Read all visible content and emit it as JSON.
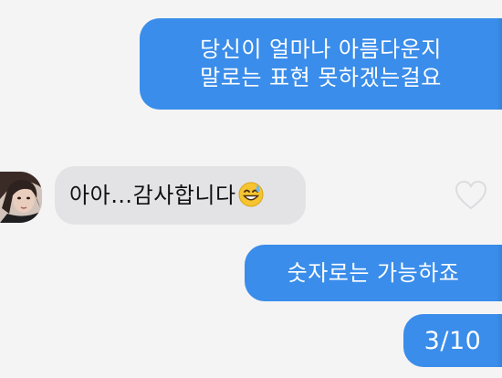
{
  "messages": [
    {
      "direction": "sent",
      "lines": [
        "당신이 얼마나 아름다운지",
        "말로는 표현 못하겠는걸요"
      ]
    },
    {
      "direction": "received",
      "text": "아아…감사합니다",
      "emoji": "grinning-sweat-emoji"
    },
    {
      "direction": "sent",
      "text": "숫자로는 가능하죠"
    },
    {
      "direction": "sent",
      "text": "3/10"
    }
  ],
  "icons": {
    "avatar": "contact-avatar",
    "heart": "heart-icon"
  },
  "colors": {
    "sent_bubble": "#3a8dea",
    "received_bubble": "#e3e3e5",
    "background": "#f4f4f5"
  }
}
